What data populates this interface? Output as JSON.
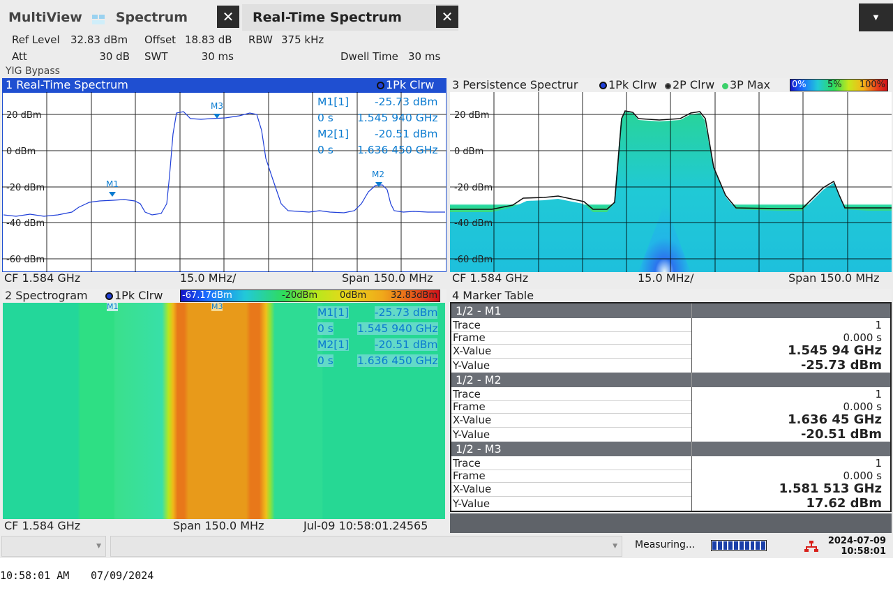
{
  "tabs": {
    "multiview": "MultiView",
    "spectrum": "Spectrum",
    "realtime": "Real-Time Spectrum",
    "close_glyph": "✕",
    "menu_glyph": "▼"
  },
  "settings": {
    "ref_level_label": "Ref Level",
    "ref_level_value": "32.83 dBm",
    "offset_label": "Offset",
    "offset_value": "18.83 dB",
    "rbw_label": "RBW",
    "rbw_value": "375 kHz",
    "att_label": "Att",
    "att_value": "30 dB",
    "swt_label": "SWT",
    "swt_value": "30 ms",
    "dwell_label": "Dwell Time",
    "dwell_value": "30 ms",
    "yig": "YIG Bypass"
  },
  "pane1": {
    "title": "1 Real-Time Spectrum",
    "legend": "1Pk Clrw",
    "y_ticks": [
      "20 dBm",
      "0 dBm",
      "-20 dBm",
      "-40 dBm",
      "-60 dBm"
    ],
    "markers": [
      "M1",
      "M2",
      "M3"
    ],
    "m1_label": "M1[1]",
    "m1_y": "-25.73 dBm",
    "m1_t": "0 s",
    "m1_x": "1.545 940 GHz",
    "m2_label": "M2[1]",
    "m2_y": "-20.51 dBm",
    "m2_t": "0 s",
    "m2_x": "1.636 450 GHz",
    "cf": "CF 1.584 GHz",
    "div": "15.0 MHz/",
    "span": "Span 150.0 MHz"
  },
  "pane2": {
    "title": "2 Spectrogram",
    "legend": "1Pk Clrw",
    "scale_min": "-67.17dBm",
    "scale_mid1": "-20dBm",
    "scale_mid2": "0dBm",
    "scale_max": "32.83dBm",
    "cf": "CF 1.584 GHz",
    "span": "Span 150.0 MHz",
    "timestamp": "Jul-09 10:58:01.24565"
  },
  "pane3": {
    "title": "3 Persistence Spectrur",
    "legend1": "1Pk Clrw",
    "legend2": "2P Clrw",
    "legend3": "3P Max",
    "scale_0": "0%",
    "scale_5": "5%",
    "scale_100": "100%",
    "y_ticks": [
      "20 dBm",
      "0 dBm",
      "-20 dBm",
      "-40 dBm",
      "-60 dBm"
    ],
    "cf": "CF 1.584 GHz",
    "div": "15.0 MHz/",
    "span": "Span 150.0 MHz"
  },
  "marker_table": {
    "title": "4 Marker Table",
    "groups": [
      {
        "head": "1/2 - M1",
        "trace": "1",
        "frame": "0.000 s",
        "x": "1.545 94 GHz",
        "y": "-25.73 dBm"
      },
      {
        "head": "1/2 - M2",
        "trace": "1",
        "frame": "0.000 s",
        "x": "1.636 45 GHz",
        "y": "-20.51 dBm"
      },
      {
        "head": "1/2 - M3",
        "trace": "1",
        "frame": "0.000 s",
        "x": "1.581 513 GHz",
        "y": "17.62 dBm"
      }
    ],
    "row_labels": {
      "trace": "Trace",
      "frame": "Frame",
      "x": "X-Value",
      "y": "Y-Value"
    }
  },
  "status": {
    "measuring": "Measuring...",
    "date": "2024-07-09",
    "time": "10:58:01",
    "progress": 1.0
  },
  "clock": {
    "time": "10:58:01 AM",
    "date": "07/09/2024"
  },
  "colors": {
    "active_title": "#1f4fd1",
    "trace": "#1f3fd8",
    "marker": "#0a7bd0"
  }
}
